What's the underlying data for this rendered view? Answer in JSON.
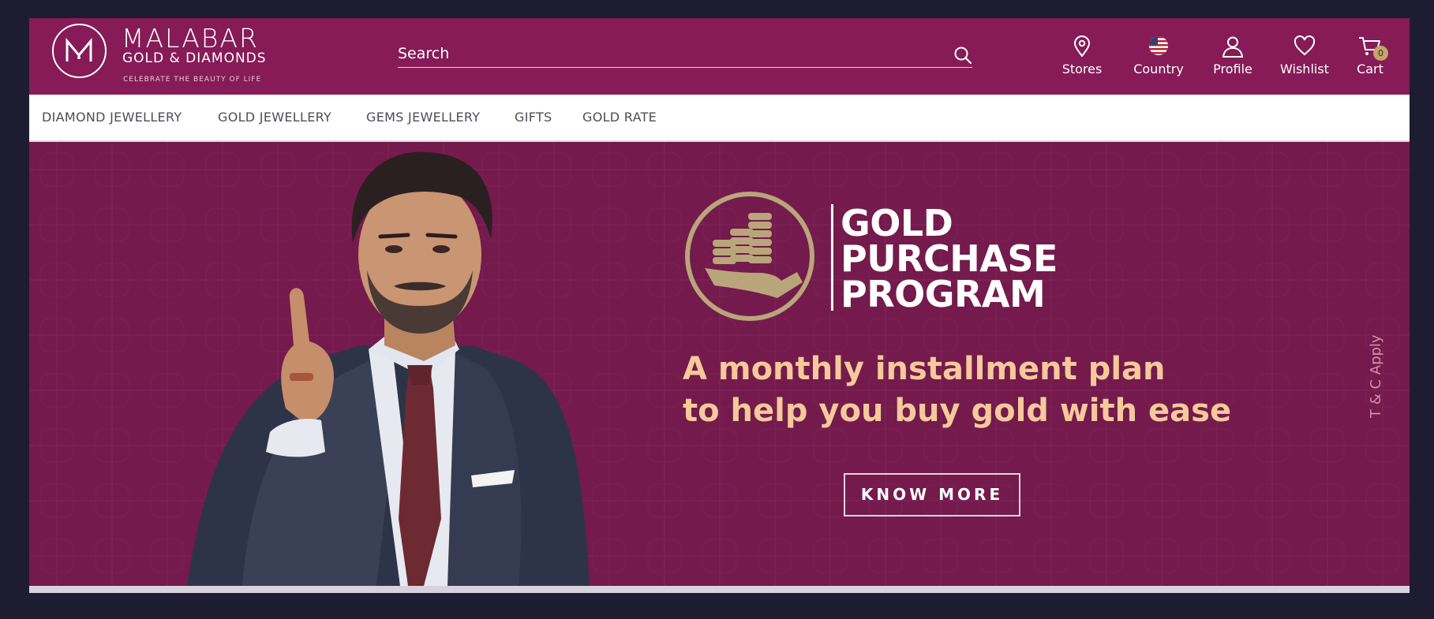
{
  "brand": {
    "name": "MALABAR",
    "subtitle": "GOLD & DIAMONDS",
    "tagline": "CELEBRATE THE BEAUTY OF LIFE",
    "color": "#861b58"
  },
  "search": {
    "placeholder": "Search",
    "value": ""
  },
  "header_nav": [
    {
      "label": "Stores",
      "icon": "location-pin-icon"
    },
    {
      "label": "Country",
      "icon": "us-flag-icon"
    },
    {
      "label": "Profile",
      "icon": "user-icon"
    },
    {
      "label": "Wishlist",
      "icon": "heart-icon"
    },
    {
      "label": "Cart",
      "icon": "cart-icon",
      "badge": "0"
    }
  ],
  "main_nav": [
    "DIAMOND JEWELLERY",
    "GOLD JEWELLERY",
    "GEMS JEWELLERY",
    "GIFTS",
    "GOLD RATE"
  ],
  "banner": {
    "title_lines": [
      "GOLD",
      "PURCHASE",
      "PROGRAM"
    ],
    "tagline_lines": [
      "A monthly installment plan",
      "to help you buy gold with ease"
    ],
    "cta": "KNOW MORE",
    "disclaimer": "T & C Apply",
    "colors": {
      "background": "#741a4d",
      "gold": "#b9a57a",
      "tagline": "#f5c99a"
    }
  }
}
